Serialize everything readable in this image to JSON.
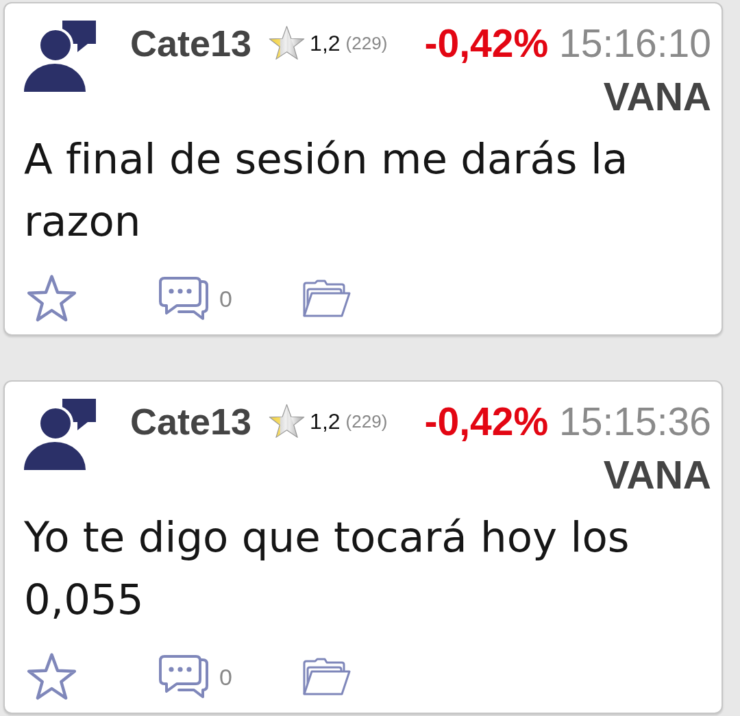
{
  "posts": [
    {
      "author": "Cate13",
      "rating": "1,2",
      "rating_count": "(229)",
      "change": "-0,42%",
      "time": "15:16:10",
      "ticker": "VANA",
      "message": "A final de sesión me darás la razon",
      "favorited": false,
      "comment_count": "0"
    },
    {
      "author": "Cate13",
      "rating": "1,2",
      "rating_count": "(229)",
      "change": "-0,42%",
      "time": "15:15:36",
      "ticker": "VANA",
      "message": "Yo te digo que tocará hoy los 0,055",
      "favorited": false,
      "comment_count": "0"
    }
  ]
}
